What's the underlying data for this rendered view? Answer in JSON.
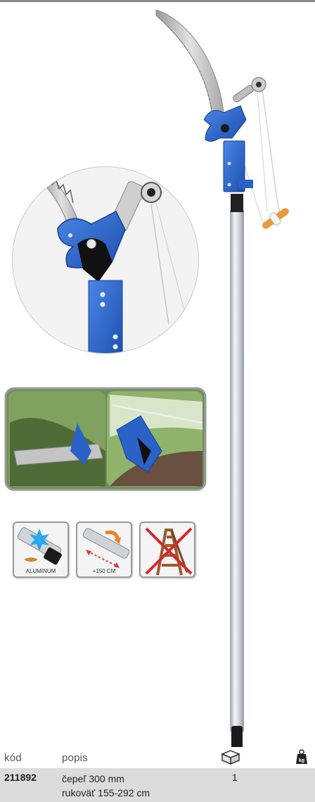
{
  "table": {
    "headers": {
      "code": "kód",
      "description": "popis",
      "package_icon": "box-icon",
      "weight_icon": "kg-weight-icon",
      "weight_icon_text": "kg"
    },
    "row": {
      "code": "211892",
      "description_line1": "čepeľ 300 mm",
      "description_line2": "rukoväť 155-292 cm",
      "quantity": "1"
    }
  },
  "features": [
    {
      "name": "aluminum-icon",
      "caption": "ALUMINUM"
    },
    {
      "name": "extension-icon",
      "caption": "+150 CM"
    },
    {
      "name": "no-ladder-icon",
      "caption": ""
    }
  ],
  "colors": {
    "blade": "#b9b9b9",
    "head_blue": "#2b62c8",
    "pole": "#d8dde3",
    "handle_orange": "#e69a3a",
    "table_row_bg": "#dcdcdc"
  }
}
